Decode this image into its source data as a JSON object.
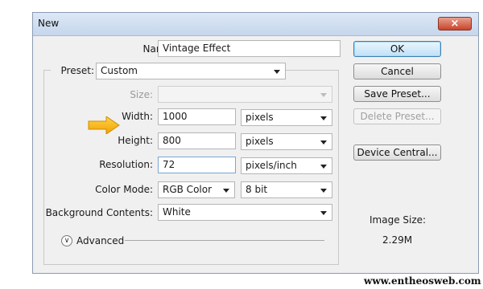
{
  "window": {
    "title": "New",
    "close_symbol": "×"
  },
  "form": {
    "name": {
      "label": "Name:",
      "value": "Vintage Effect"
    },
    "preset": {
      "label": "Preset:",
      "value": "Custom"
    },
    "size": {
      "label": "Size:",
      "value": ""
    },
    "width": {
      "label": "Width:",
      "value": "1000",
      "unit": "pixels"
    },
    "height": {
      "label": "Height:",
      "value": "800",
      "unit": "pixels"
    },
    "resolution": {
      "label": "Resolution:",
      "value": "72",
      "unit": "pixels/inch"
    },
    "color_mode": {
      "label": "Color Mode:",
      "value": "RGB Color",
      "depth": "8 bit"
    },
    "background": {
      "label": "Background Contents:",
      "value": "White"
    },
    "advanced": {
      "label": "Advanced"
    }
  },
  "buttons": {
    "ok": "OK",
    "cancel": "Cancel",
    "save_preset": "Save Preset...",
    "delete_preset": "Delete Preset...",
    "device_central": "Device Central..."
  },
  "image_size": {
    "label": "Image Size:",
    "value": "2.29M"
  },
  "watermark": "www.entheosweb.com",
  "colors": {
    "arrow": "#f5a800",
    "title_bar": "#c6d6ec",
    "close_button": "#c8442b",
    "default_button_border": "#3c7fb1"
  },
  "icons": {
    "arrow": "arrow-right-icon",
    "close": "close-icon",
    "advanced_toggle": "chevron-double-down-icon"
  }
}
